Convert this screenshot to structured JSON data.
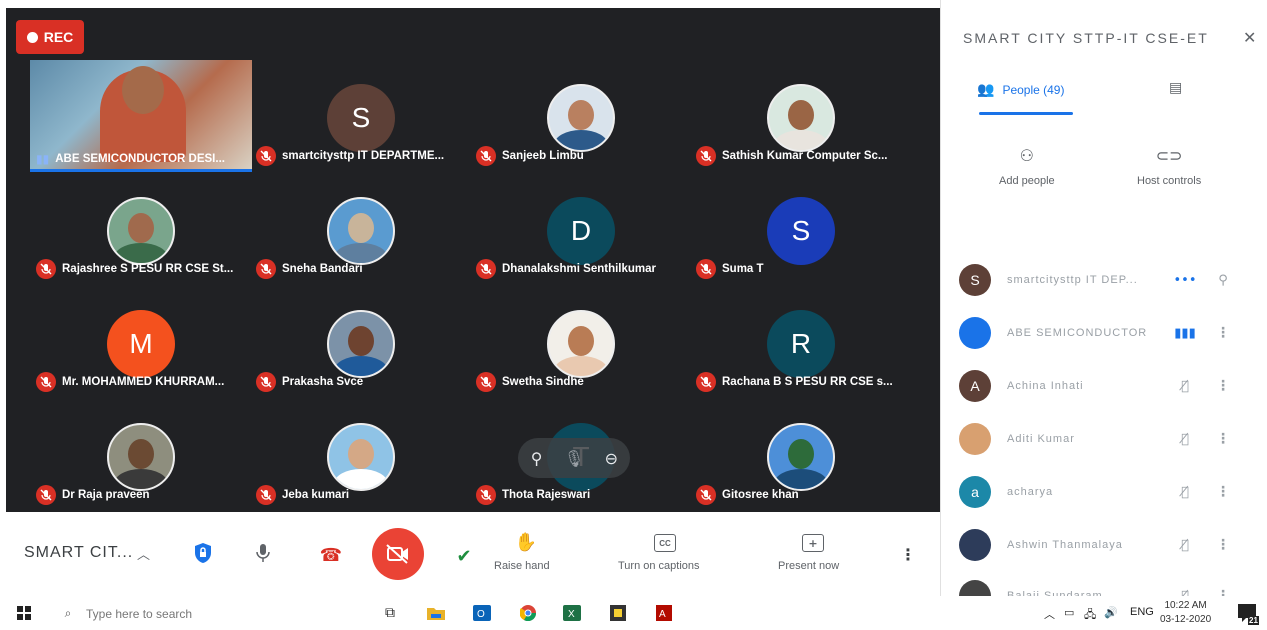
{
  "recording": {
    "label": "REC"
  },
  "tiles": [
    {
      "name": "ABE SEMICONDUCTOR DESI...",
      "type": "video"
    },
    {
      "name": "smartcitysttp IT DEPARTME...",
      "type": "letter",
      "letter": "S",
      "color": "#5d4037"
    },
    {
      "name": "Sanjeeb Limbu",
      "type": "photo",
      "skin": "#b98060",
      "shirt": "#2d5a8a",
      "bg": "#d9e3ec"
    },
    {
      "name": "Sathish Kumar Computer Sc...",
      "type": "photo",
      "skin": "#9a6545",
      "shirt": "#e8e4de",
      "bg": "#d9e8e0"
    },
    {
      "name": "Rajashree S PESU RR CSE St...",
      "type": "photo",
      "skin": "#a06a4d",
      "shirt": "#3a6b4a",
      "bg": "#7aa58c"
    },
    {
      "name": "Sneha Bandari",
      "type": "photo",
      "skin": "#c8b49a",
      "shirt": "#5e7f9f",
      "bg": "#5a9bd0"
    },
    {
      "name": "Dhanalakshmi Senthilkumar",
      "type": "letter",
      "letter": "D",
      "color": "#0b4a5c"
    },
    {
      "name": "Suma T",
      "type": "letter",
      "letter": "S",
      "color": "#1a3cb8"
    },
    {
      "name": "Mr. MOHAMMED KHURRAM...",
      "type": "letter",
      "letter": "M",
      "color": "#f4511e"
    },
    {
      "name": "Prakasha Svce",
      "type": "photo",
      "skin": "#6e4330",
      "shirt": "#1f5a9a",
      "bg": "#7c92a8"
    },
    {
      "name": "Swetha Sindhe",
      "type": "photo",
      "skin": "#b97c55",
      "shirt": "#e9c9b0",
      "bg": "#f2efe9"
    },
    {
      "name": "Rachana B S PESU RR CSE s...",
      "type": "letter",
      "letter": "R",
      "color": "#0b4a5c"
    },
    {
      "name": "Dr Raja praveen",
      "type": "photo",
      "skin": "#6b4a33",
      "shirt": "#3a3a3a",
      "bg": "#8e8e7e"
    },
    {
      "name": "Jeba kumari",
      "type": "photo",
      "skin": "#d4a886",
      "shirt": "#ffffff",
      "bg": "#8fc3e6"
    },
    {
      "name": "Thota Rajeswari",
      "type": "letter",
      "letter": "T",
      "color": "#0b4a5c"
    },
    {
      "name": "Gitosree khan",
      "type": "photo",
      "skin": "#2d6b3a",
      "shirt": "#1c4d7a",
      "bg": "#4d8fd8"
    }
  ],
  "bottom_bar": {
    "meeting_title": "SMART CIT...",
    "raise_hand": "Raise hand",
    "captions": "Turn on captions",
    "present": "Present now"
  },
  "panel": {
    "title": "SMART CITY STTP-IT CSE-ET",
    "people_tab": "People (49)",
    "add_people": "Add people",
    "host_controls": "Host controls",
    "participants": [
      {
        "name": "smartcitysttp IT DEP...",
        "letter": "S",
        "color": "#5d4037",
        "state": "•••"
      },
      {
        "name": "ABE SEMICONDUCTOR",
        "letter": "",
        "color": "#1a73e8",
        "state": "▮▮▮"
      },
      {
        "name": "Achina Inhati",
        "letter": "A",
        "color": "#5d4037",
        "state": "mic-off"
      },
      {
        "name": "Aditi Kumar",
        "letter": "",
        "color": "#d8a070",
        "state": "mic-off"
      },
      {
        "name": "acharya",
        "letter": "a",
        "color": "#1c88a8",
        "state": "mic-off"
      },
      {
        "name": "Ashwin Thanmalaya",
        "letter": "",
        "color": "#2d3c5a",
        "state": "mic-off"
      },
      {
        "name": "Balaji Sundaram",
        "letter": "",
        "color": "#444444",
        "state": "mic-off"
      }
    ]
  },
  "taskbar": {
    "search_placeholder": "Type here to search",
    "language": "ENG",
    "time": "10:22 AM",
    "date": "03-12-2020",
    "notifications": "21"
  },
  "colors": {
    "meet_bg": "#202124",
    "red": "#d93025",
    "accent_blue": "#1a73e8",
    "green": "#1e8e3e"
  }
}
